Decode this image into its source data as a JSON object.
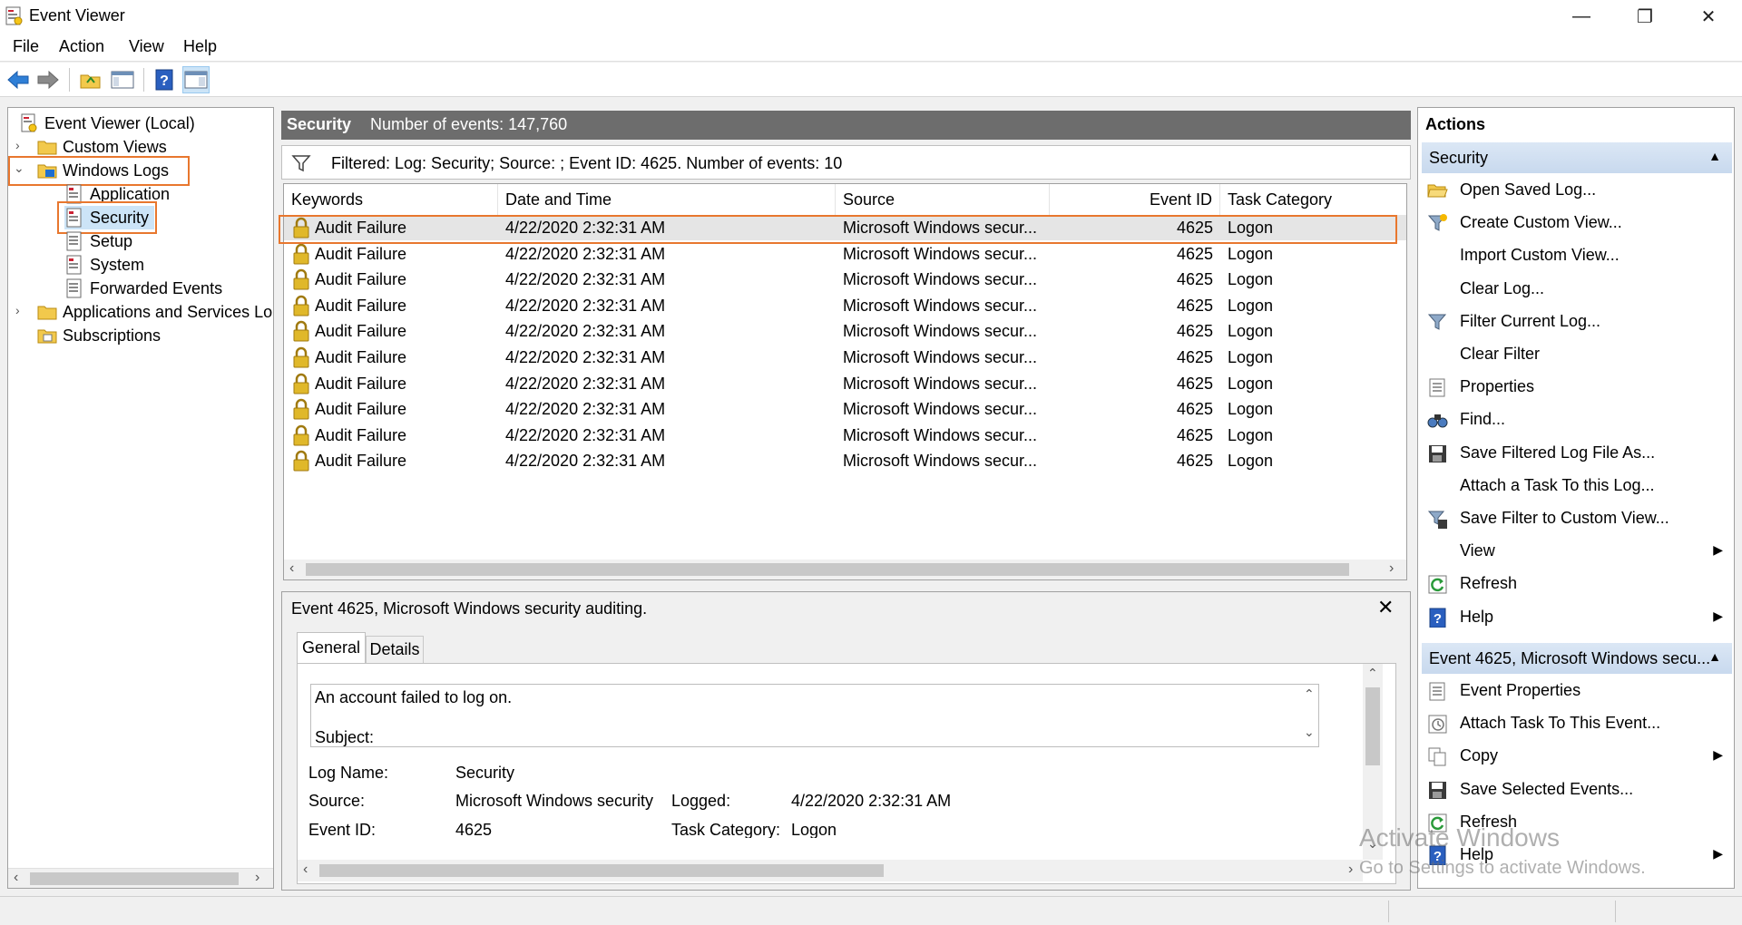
{
  "window": {
    "title": "Event Viewer",
    "controls": {
      "minimize": "—",
      "maximize": "❐",
      "close": "✕"
    }
  },
  "menu": [
    "File",
    "Action",
    "View",
    "Help"
  ],
  "tree": {
    "root": "Event Viewer (Local)",
    "custom_views": "Custom Views",
    "windows_logs": "Windows Logs",
    "application": "Application",
    "security": "Security",
    "setup": "Setup",
    "system": "System",
    "forwarded_events": "Forwarded Events",
    "apps_services": "Applications and Services Lo",
    "subscriptions": "Subscriptions"
  },
  "center": {
    "log_name": "Security",
    "event_count": "Number of events: 147,760",
    "filter_text": "Filtered: Log: Security; Source: ; Event ID: 4625. Number of events: 10",
    "columns": [
      "Keywords",
      "Date and Time",
      "Source",
      "Event ID",
      "Task Category"
    ],
    "rows": [
      {
        "keyword": "Audit Failure",
        "datetime": "4/22/2020 2:32:31 AM",
        "source": "Microsoft Windows secur...",
        "event_id": "4625",
        "category": "Logon"
      },
      {
        "keyword": "Audit Failure",
        "datetime": "4/22/2020 2:32:31 AM",
        "source": "Microsoft Windows secur...",
        "event_id": "4625",
        "category": "Logon"
      },
      {
        "keyword": "Audit Failure",
        "datetime": "4/22/2020 2:32:31 AM",
        "source": "Microsoft Windows secur...",
        "event_id": "4625",
        "category": "Logon"
      },
      {
        "keyword": "Audit Failure",
        "datetime": "4/22/2020 2:32:31 AM",
        "source": "Microsoft Windows secur...",
        "event_id": "4625",
        "category": "Logon"
      },
      {
        "keyword": "Audit Failure",
        "datetime": "4/22/2020 2:32:31 AM",
        "source": "Microsoft Windows secur...",
        "event_id": "4625",
        "category": "Logon"
      },
      {
        "keyword": "Audit Failure",
        "datetime": "4/22/2020 2:32:31 AM",
        "source": "Microsoft Windows secur...",
        "event_id": "4625",
        "category": "Logon"
      },
      {
        "keyword": "Audit Failure",
        "datetime": "4/22/2020 2:32:31 AM",
        "source": "Microsoft Windows secur...",
        "event_id": "4625",
        "category": "Logon"
      },
      {
        "keyword": "Audit Failure",
        "datetime": "4/22/2020 2:32:31 AM",
        "source": "Microsoft Windows secur...",
        "event_id": "4625",
        "category": "Logon"
      },
      {
        "keyword": "Audit Failure",
        "datetime": "4/22/2020 2:32:31 AM",
        "source": "Microsoft Windows secur...",
        "event_id": "4625",
        "category": "Logon"
      },
      {
        "keyword": "Audit Failure",
        "datetime": "4/22/2020 2:32:31 AM",
        "source": "Microsoft Windows secur...",
        "event_id": "4625",
        "category": "Logon"
      }
    ]
  },
  "preview": {
    "title": "Event 4625, Microsoft Windows security auditing.",
    "tabs": [
      "General",
      "Details"
    ],
    "description_line1": "An account failed to log on.",
    "description_line2": "Subject:",
    "log_name_label": "Log Name:",
    "log_name_value": "Security",
    "source_label": "Source:",
    "source_value": "Microsoft Windows security",
    "logged_label": "Logged:",
    "logged_value": "4/22/2020 2:32:31 AM",
    "event_id_label": "Event ID:",
    "event_id_value": "4625",
    "task_category_label": "Task Category:",
    "task_category_value": "Logon"
  },
  "actions": {
    "header": "Actions",
    "section1": "Security",
    "items1": [
      {
        "label": "Open Saved Log...",
        "icon": "folder-open-icon",
        "submenu": false
      },
      {
        "label": "Create Custom View...",
        "icon": "filter-star-icon",
        "submenu": false
      },
      {
        "label": "Import Custom View...",
        "icon": "",
        "submenu": false
      },
      {
        "label": "Clear Log...",
        "icon": "",
        "submenu": false
      },
      {
        "label": "Filter Current Log...",
        "icon": "filter-icon",
        "submenu": false
      },
      {
        "label": "Clear Filter",
        "icon": "",
        "submenu": false
      },
      {
        "label": "Properties",
        "icon": "properties-icon",
        "submenu": false
      },
      {
        "label": "Find...",
        "icon": "binoculars-icon",
        "submenu": false
      },
      {
        "label": "Save Filtered Log File As...",
        "icon": "save-icon",
        "submenu": false
      },
      {
        "label": "Attach a Task To this Log...",
        "icon": "",
        "submenu": false
      },
      {
        "label": "Save Filter to Custom View...",
        "icon": "save-filter-icon",
        "submenu": false
      },
      {
        "label": "View",
        "icon": "",
        "submenu": true
      },
      {
        "label": "Refresh",
        "icon": "refresh-icon",
        "submenu": false
      },
      {
        "label": "Help",
        "icon": "help-icon",
        "submenu": true
      }
    ],
    "section2": "Event 4625, Microsoft Windows secu...",
    "items2": [
      {
        "label": "Event Properties",
        "icon": "properties-icon",
        "submenu": false
      },
      {
        "label": "Attach Task To This Event...",
        "icon": "task-icon",
        "submenu": false
      },
      {
        "label": "Copy",
        "icon": "copy-icon",
        "submenu": true
      },
      {
        "label": "Save Selected Events...",
        "icon": "save-icon",
        "submenu": false
      },
      {
        "label": "Refresh",
        "icon": "refresh-icon",
        "submenu": false
      },
      {
        "label": "Help",
        "icon": "help-icon",
        "submenu": true
      }
    ]
  },
  "watermark": {
    "line1": "Activate Windows",
    "line2": "Go to Settings to activate Windows."
  },
  "colors": {
    "highlight_border": "#e8772e",
    "selected_row": "#e5e5e5",
    "header_dark": "#6d6d6d",
    "section_blue": "#c8d9ee"
  }
}
